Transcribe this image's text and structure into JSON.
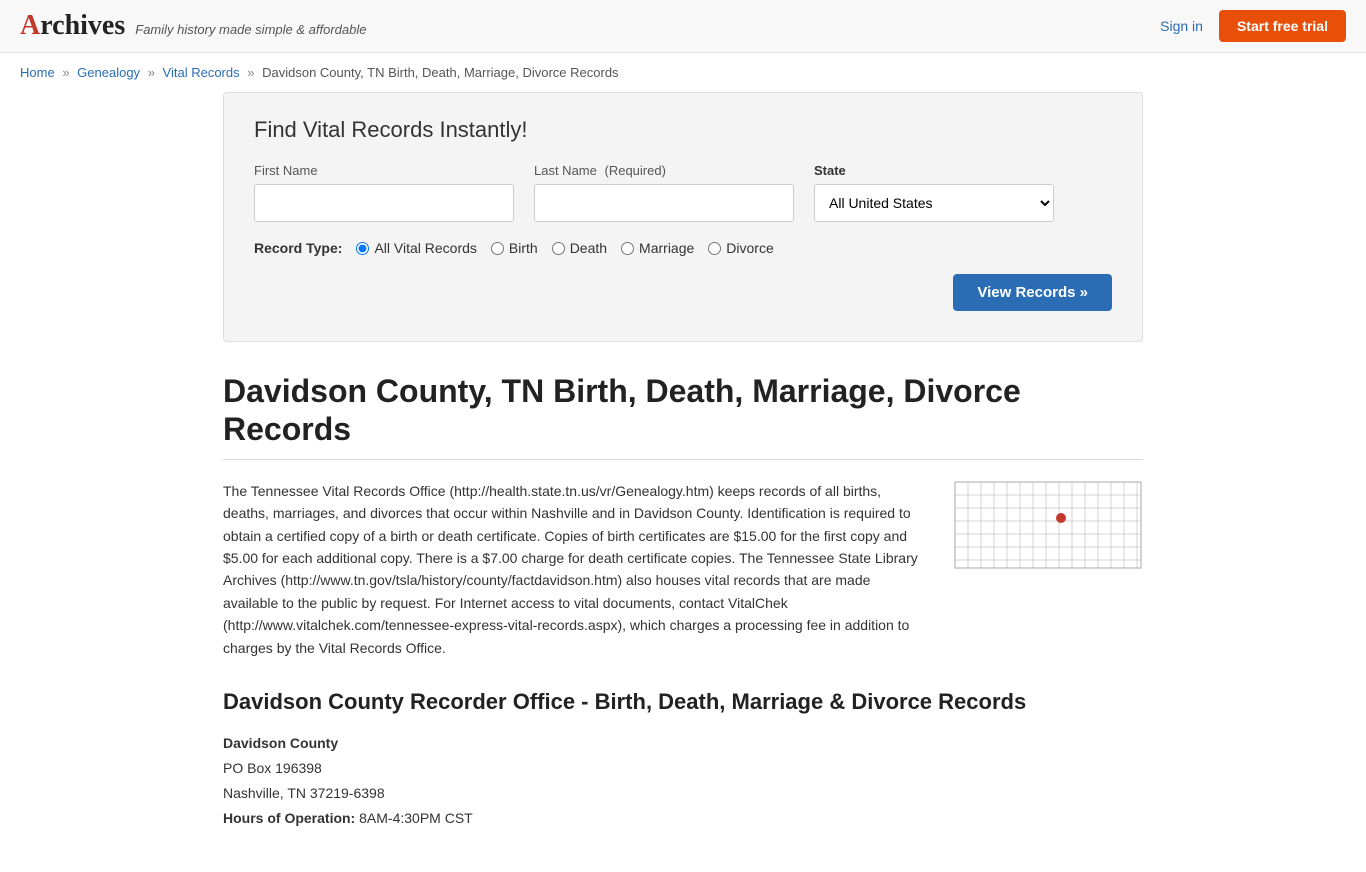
{
  "header": {
    "logo": "Archives",
    "tagline": "Family history made simple & affordable",
    "sign_in_label": "Sign in",
    "trial_button_label": "Start free trial"
  },
  "breadcrumb": {
    "home_label": "Home",
    "genealogy_label": "Genealogy",
    "vital_records_label": "Vital Records",
    "current_label": "Davidson County, TN Birth, Death, Marriage, Divorce Records"
  },
  "search": {
    "title": "Find Vital Records Instantly!",
    "first_name_label": "First Name",
    "last_name_label": "Last Name",
    "last_name_required": "(Required)",
    "state_label": "State",
    "state_default": "All United States",
    "record_type_label": "Record Type:",
    "record_types": [
      "All Vital Records",
      "Birth",
      "Death",
      "Marriage",
      "Divorce"
    ],
    "view_records_btn": "View Records »"
  },
  "page": {
    "title": "Davidson County, TN Birth, Death, Marriage, Divorce Records",
    "description": "The Tennessee Vital Records Office (http://health.state.tn.us/vr/Genealogy.htm) keeps records of all births, deaths, marriages, and divorces that occur within Nashville and in Davidson County. Identification is required to obtain a certified copy of a birth or death certificate. Copies of birth certificates are $15.00 for the first copy and $5.00 for each additional copy. There is a $7.00 charge for death certificate copies. The Tennessee State Library Archives (http://www.tn.gov/tsla/history/county/factdavidson.htm) also houses vital records that are made available to the public by request. For Internet access to vital documents, contact VitalChek (http://www.vitalchek.com/tennessee-express-vital-records.aspx), which charges a processing fee in addition to charges by the Vital Records Office."
  },
  "recorder": {
    "section_title": "Davidson County Recorder Office - Birth, Death, Marriage & Divorce Records",
    "name": "Davidson County",
    "address_line1": "PO Box 196398",
    "address_line2": "Nashville, TN 37219-6398",
    "hours_label": "Hours of Operation:",
    "hours_value": "8AM-4:30PM CST"
  },
  "colors": {
    "link": "#2a6db5",
    "trial_btn": "#e8500a",
    "view_records_btn": "#2a6db5"
  }
}
